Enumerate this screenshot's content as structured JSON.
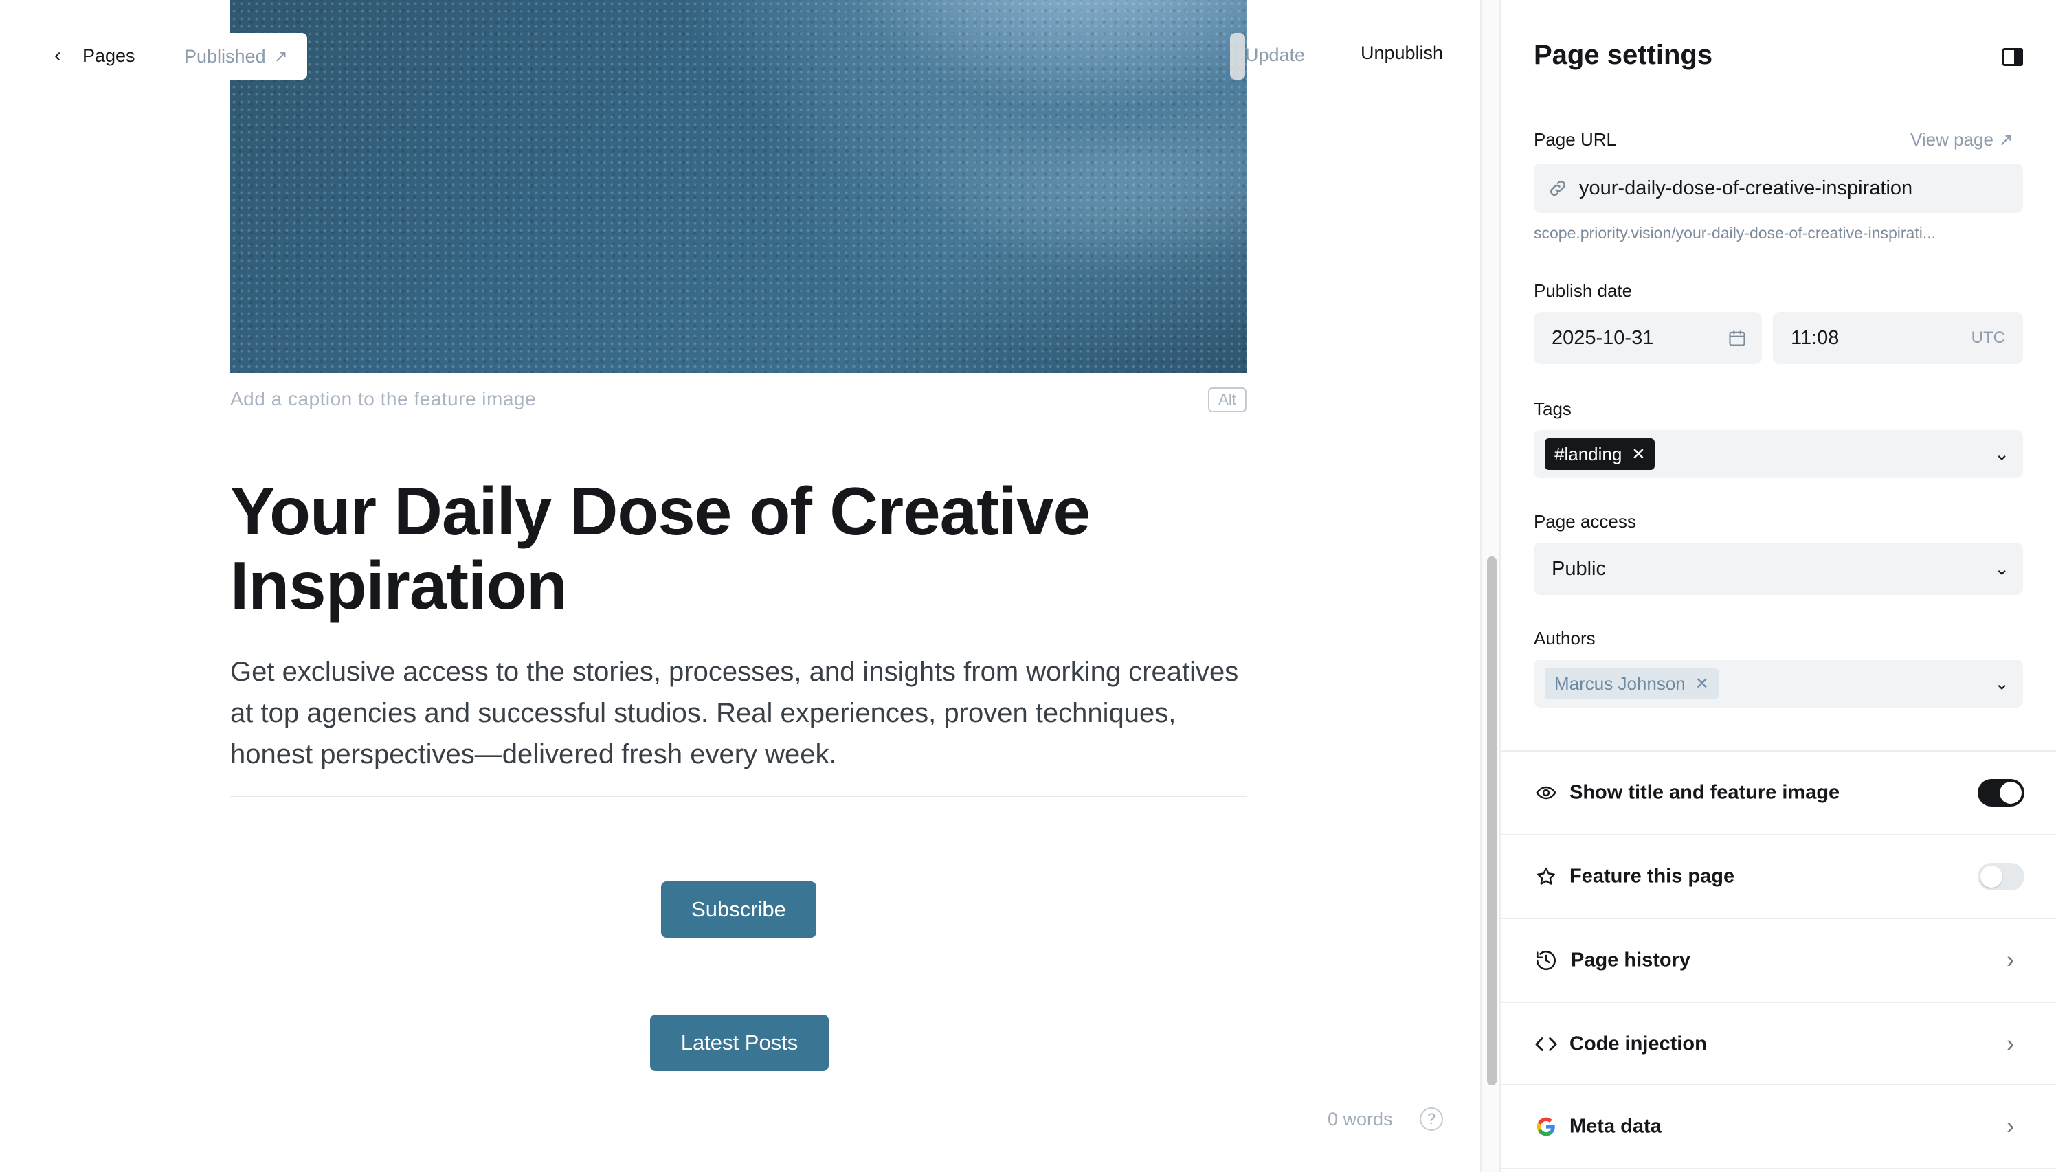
{
  "topbar": {
    "back_label": "Pages",
    "status_label": "Published",
    "status_arrow": "↗",
    "update_label": "Update",
    "unpublish_label": "Unpublish"
  },
  "editor": {
    "caption_placeholder": "Add a caption to the feature image",
    "alt_label": "Alt",
    "title": "Your Daily Dose of Creative Inspiration",
    "excerpt": "Get exclusive access to the stories, processes, and insights from working creatives at top agencies and successful studios. Real experiences, proven techniques, honest perspectives—delivered fresh every week.",
    "buttons": {
      "subscribe": "Subscribe",
      "latest_posts": "Latest Posts"
    },
    "word_count": "0 words",
    "help": "?"
  },
  "settings": {
    "title": "Page settings",
    "page_url": {
      "label": "Page URL",
      "view_page": "View page ↗",
      "slug": "your-daily-dose-of-creative-inspiration",
      "full_url_hint": "scope.priority.vision/your-daily-dose-of-creative-inspirati..."
    },
    "publish_date": {
      "label": "Publish date",
      "date": "2025-10-31",
      "time": "11:08",
      "timezone": "UTC"
    },
    "tags": {
      "label": "Tags",
      "items": [
        "#landing"
      ]
    },
    "page_access": {
      "label": "Page access",
      "value": "Public"
    },
    "authors": {
      "label": "Authors",
      "items": [
        "Marcus Johnson"
      ]
    },
    "rows": {
      "show_title": {
        "label": "Show title and feature image",
        "enabled": true
      },
      "feature_page": {
        "label": "Feature this page",
        "enabled": false
      },
      "page_history": {
        "label": "Page history"
      },
      "code_injection": {
        "label": "Code injection"
      },
      "meta_data": {
        "label": "Meta data"
      }
    }
  },
  "colors": {
    "accent_button": "#3a7593",
    "toggle_on": "#15171a",
    "muted_text": "#8e9cac"
  }
}
